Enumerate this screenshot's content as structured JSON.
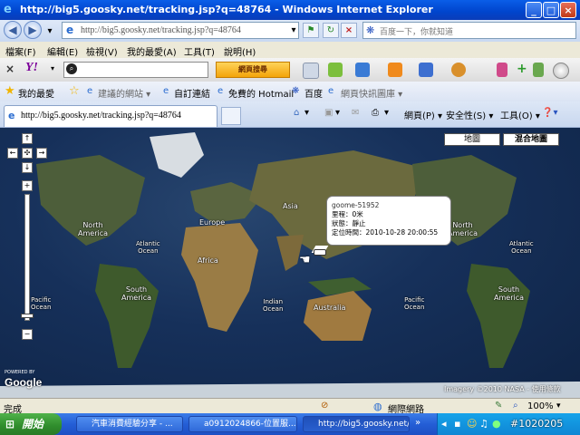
{
  "window": {
    "title": "http://big5.goosky.net/tracking.jsp?q=48764 - Windows Internet Explorer"
  },
  "address": {
    "url": "http://big5.goosky.net/tracking.jsp?q=48764"
  },
  "search": {
    "placeholder": "百度一下，你就知道"
  },
  "menu": {
    "items": [
      "檔案(F)",
      "編輯(E)",
      "檢視(V)",
      "我的最愛(A)",
      "工具(T)",
      "說明(H)"
    ]
  },
  "yahoo": {
    "close": "×",
    "logo": "Y!",
    "search_button": "網頁搜尋"
  },
  "favorites": {
    "label": "我的最愛",
    "items": [
      "建議的網站 ▾",
      "自訂連結",
      "免費的 Hotmail",
      "百度",
      "網頁快訊圖庫 ▾"
    ]
  },
  "tab": {
    "title": "http://big5.goosky.net/tracking.jsp?q=48764"
  },
  "tabtools": {
    "page": "網頁(P) ▾",
    "safety": "安全性(S) ▾",
    "tools": "工具(O) ▾"
  },
  "map": {
    "buttons": {
      "map": "地圖",
      "hybrid": "混合地圖"
    },
    "labels": {
      "north_america_w": "North\nAmerica",
      "north_america_e": "North\nAmerica",
      "atlantic_w": "Atlantic\nOcean",
      "atlantic_e": "Atlantic\nOcean",
      "south_america_w": "South\nAmerica",
      "south_america_e": "South\nAmerica",
      "pacific_w": "Pacific\nOcean",
      "pacific_e": "Pacific\nOcean",
      "europe": "Europe",
      "asia": "Asia",
      "africa": "Africa",
      "indian": "Indian\nOcean",
      "australia": "Australia"
    },
    "info": {
      "device": "goome-51952",
      "mileage": "里程：0米",
      "status": "狀態：靜止",
      "time": "定位時間：2010-10-28 20:00:55"
    },
    "powered_by": "POWERED BY",
    "google": "Google",
    "copyright": "Imagery ©2010 NASA - 使用條款"
  },
  "status": {
    "text": "完成",
    "zone": "網際網路",
    "zoom": "100%"
  },
  "taskbar": {
    "start": "開始",
    "buttons": [
      "汽車消費經驗分享 - ...",
      "a0912024866-位置服...",
      "http://big5.goosky.net/..."
    ],
    "watermark": "#1020205"
  }
}
